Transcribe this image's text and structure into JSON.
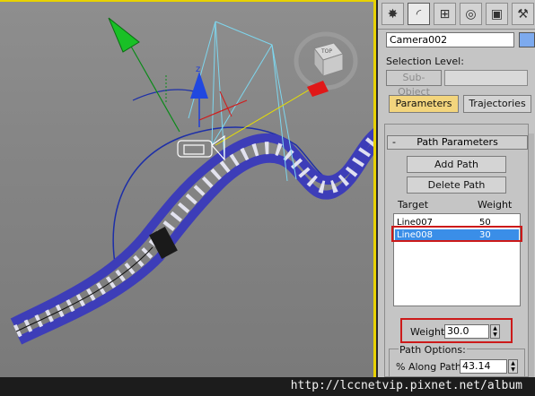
{
  "command_panel": {
    "tab_icons": [
      "create-icon",
      "modify-icon",
      "hierarchy-icon",
      "motion-icon",
      "display-icon",
      "utilities-icon"
    ],
    "object_name": "Camera002",
    "object_color": "#7daaee",
    "selection_level_label": "Selection Level:",
    "sub_object_label": "Sub-Object",
    "parameters_tab": "Parameters",
    "trajectories_tab": "Trajectories",
    "active_tab_color": "#f3d57d",
    "rollout_title": "Path Parameters",
    "rollout_toggle": "-",
    "add_path_label": "Add Path",
    "delete_path_label": "Delete Path",
    "target_header": "Target",
    "weight_header": "Weight",
    "targets": [
      {
        "name": "Line007",
        "weight": "50"
      },
      {
        "name": "Line008",
        "weight": "30"
      }
    ],
    "selected_target_color": "#3a8ee8",
    "weight_label": "Weight",
    "weight_value": "30.0",
    "path_options_label": "Path Options:",
    "along_path_label": "% Along Path:",
    "along_path_value": "43.14"
  },
  "highlight_color": "#cc1a1a",
  "viewport": {
    "active_border_color": "#e8d200",
    "axis_z_label": "z",
    "viewcube_label": "TOP"
  },
  "footer": {
    "watermark": "http://lccnetvip.pixnet.net/album"
  }
}
